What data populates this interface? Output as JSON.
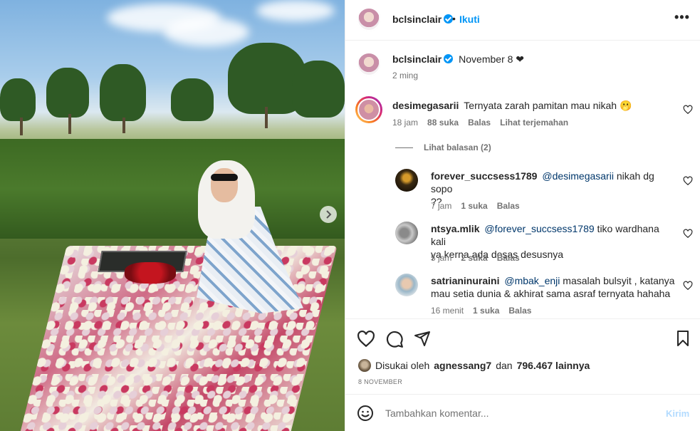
{
  "header": {
    "username": "bclsinclair",
    "separator": "•",
    "follow_label": "Ikuti",
    "more_label": "•••"
  },
  "caption": {
    "username": "bclsinclair",
    "text": "November 8 ❤",
    "time": "2 ming"
  },
  "comments": [
    {
      "username": "desimegasarii",
      "text": "Ternyata zarah pamitan mau nikah 🫢",
      "time": "18 jam",
      "likes": "88 suka",
      "reply": "Balas",
      "translate": "Lihat terjemahan",
      "view_replies": "Lihat balasan (2)"
    },
    {
      "username": "forever_succsess1789",
      "mention": "@desimegasarii",
      "text_line1": " nikah dg sopo",
      "text_line2": "??",
      "time": "7 jam",
      "likes": "1 suka",
      "reply": "Balas"
    },
    {
      "username": "ntsya.mlik",
      "mention": "@forever_succsess1789",
      "text_line1": " tiko wardhana kali",
      "text_line2": "ya kerna ada desas desusnya",
      "time": "5 jam",
      "likes": "2 suka",
      "reply": "Balas"
    },
    {
      "username": "satrianinuraini",
      "mention": "@mbak_enji",
      "text_line1": " masalah bulsyit , katanya",
      "text_line2": "mau setia dunia & akhirat sama asraf ternyata hahaha",
      "time": "16 menit",
      "likes": "1 suka",
      "reply": "Balas"
    }
  ],
  "actions": {
    "liked_by_prefix": "Disukai oleh",
    "liked_by_user": "agnessang7",
    "liked_by_and": "dan",
    "liked_by_count": "796.467 lainnya",
    "date": "8 NOVEMBER"
  },
  "composer": {
    "placeholder": "Tambahkan komentar...",
    "post_label": "Kirim"
  },
  "colors": {
    "accent": "#0095f6",
    "muted_text": "#737373",
    "post_disabled": "#b3dbff"
  },
  "icons": {
    "like": "heart-icon",
    "comment": "comment-icon",
    "share": "share-icon",
    "save": "bookmark-icon",
    "emoji": "emoji-icon",
    "next": "chevron-right-icon",
    "verified": "verified-badge-icon"
  }
}
